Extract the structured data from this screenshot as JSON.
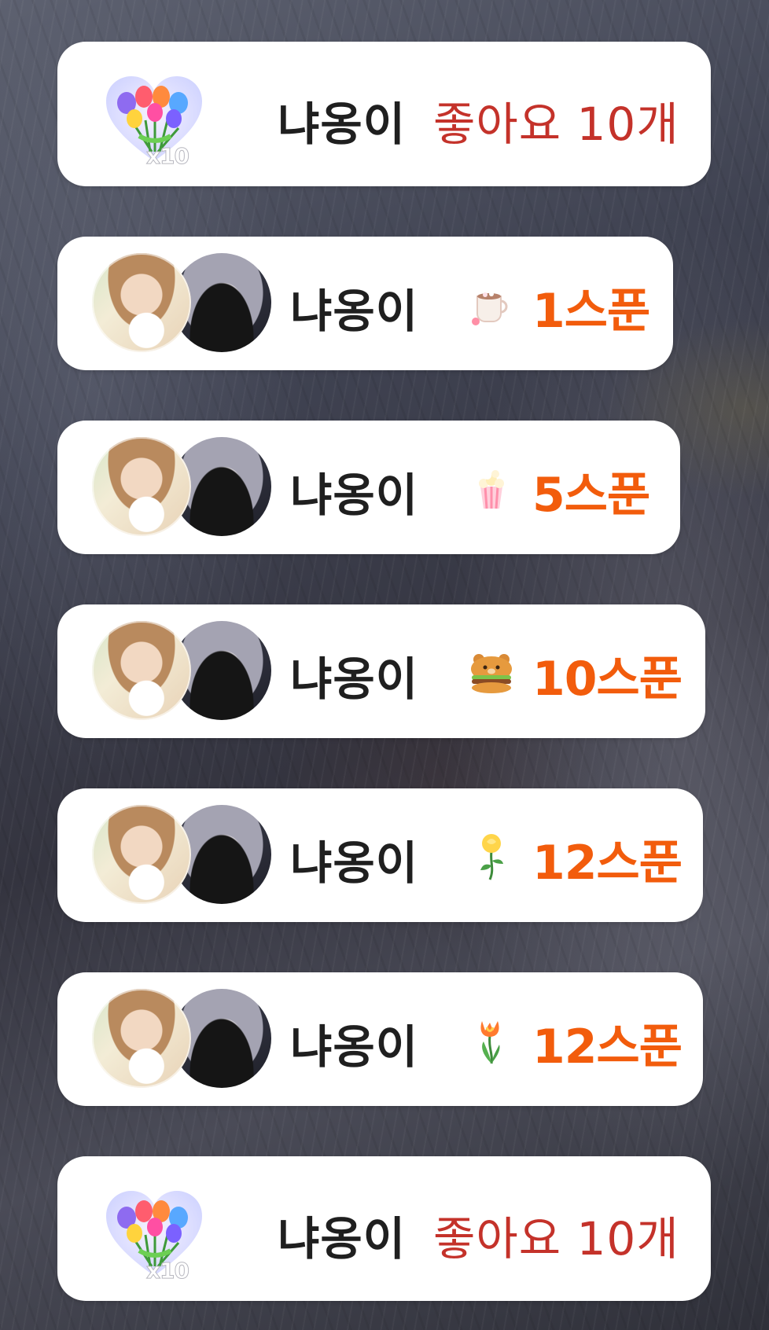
{
  "colors": {
    "like_text": "#c4322a",
    "spoon_amount": "#f25c0c",
    "name_text": "#1f1f1f",
    "card_bg": "#ffffff"
  },
  "items": [
    {
      "type": "like",
      "name": "냐옹이",
      "text": "좋아요 10개",
      "multiplier": "x10",
      "icon": "heart-flower-bouquet-icon"
    },
    {
      "type": "gift",
      "name": "냐옹이",
      "amount": "1스푼",
      "icon": "cocoa-mug-icon"
    },
    {
      "type": "gift",
      "name": "냐옹이",
      "amount": "5스푼",
      "icon": "popcorn-icon"
    },
    {
      "type": "gift",
      "name": "냐옹이",
      "amount": "10스푼",
      "icon": "bear-burger-icon"
    },
    {
      "type": "gift",
      "name": "냐옹이",
      "amount": "12스푼",
      "icon": "yellow-rose-icon"
    },
    {
      "type": "gift",
      "name": "냐옹이",
      "amount": "12스푼",
      "icon": "tulip-icon"
    },
    {
      "type": "like",
      "name": "냐옹이",
      "text": "좋아요 10개",
      "multiplier": "x10",
      "icon": "heart-flower-bouquet-icon"
    }
  ]
}
